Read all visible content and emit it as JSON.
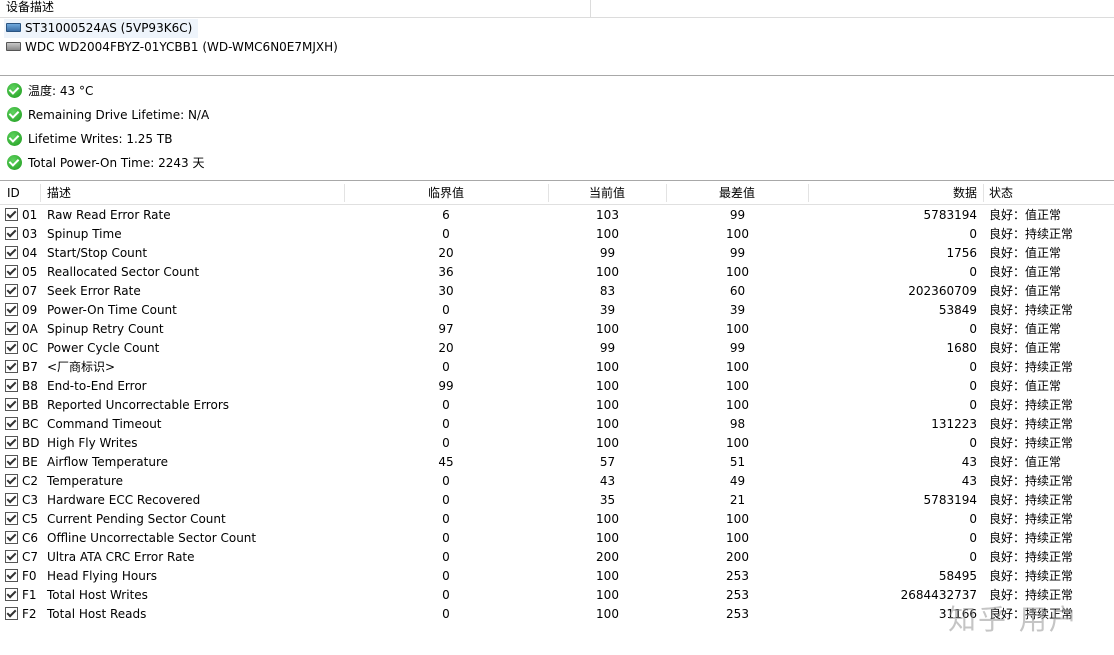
{
  "device_panel": {
    "header": "设备描述",
    "devices": [
      {
        "label": "ST31000524AS (5VP93K6C)",
        "icon": "disk-icon"
      },
      {
        "label": "WDC WD2004FBYZ-01YCBB1 (WD-WMC6N0E7MJXH)",
        "icon": "disk-icon"
      }
    ]
  },
  "status": [
    {
      "text": "温度: 43 °C",
      "icon": "ok-icon"
    },
    {
      "text": "Remaining Drive Lifetime: N/A",
      "icon": "ok-icon"
    },
    {
      "text": "Lifetime Writes: 1.25 TB",
      "icon": "ok-icon"
    },
    {
      "text": "Total Power-On Time: 2243 天",
      "icon": "ok-icon"
    }
  ],
  "table": {
    "headers": {
      "id": "ID",
      "desc": "描述",
      "threshold": "临界值",
      "current": "当前值",
      "worst": "最差值",
      "data": "数据",
      "status": "状态"
    },
    "rows": [
      {
        "id": "01",
        "desc": "Raw Read Error Rate",
        "threshold": "6",
        "current": "103",
        "worst": "99",
        "data": "5783194",
        "status": "良好：值正常"
      },
      {
        "id": "03",
        "desc": "Spinup Time",
        "threshold": "0",
        "current": "100",
        "worst": "100",
        "data": "0",
        "status": "良好：持续正常"
      },
      {
        "id": "04",
        "desc": "Start/Stop Count",
        "threshold": "20",
        "current": "99",
        "worst": "99",
        "data": "1756",
        "status": "良好：值正常"
      },
      {
        "id": "05",
        "desc": "Reallocated Sector Count",
        "threshold": "36",
        "current": "100",
        "worst": "100",
        "data": "0",
        "status": "良好：值正常"
      },
      {
        "id": "07",
        "desc": "Seek Error Rate",
        "threshold": "30",
        "current": "83",
        "worst": "60",
        "data": "202360709",
        "status": "良好：值正常"
      },
      {
        "id": "09",
        "desc": "Power-On Time Count",
        "threshold": "0",
        "current": "39",
        "worst": "39",
        "data": "53849",
        "status": "良好：持续正常"
      },
      {
        "id": "0A",
        "desc": "Spinup Retry Count",
        "threshold": "97",
        "current": "100",
        "worst": "100",
        "data": "0",
        "status": "良好：值正常"
      },
      {
        "id": "0C",
        "desc": "Power Cycle Count",
        "threshold": "20",
        "current": "99",
        "worst": "99",
        "data": "1680",
        "status": "良好：值正常"
      },
      {
        "id": "B7",
        "desc": "<厂商标识>",
        "threshold": "0",
        "current": "100",
        "worst": "100",
        "data": "0",
        "status": "良好：持续正常"
      },
      {
        "id": "B8",
        "desc": "End-to-End Error",
        "threshold": "99",
        "current": "100",
        "worst": "100",
        "data": "0",
        "status": "良好：值正常"
      },
      {
        "id": "BB",
        "desc": "Reported Uncorrectable Errors",
        "threshold": "0",
        "current": "100",
        "worst": "100",
        "data": "0",
        "status": "良好：持续正常"
      },
      {
        "id": "BC",
        "desc": "Command Timeout",
        "threshold": "0",
        "current": "100",
        "worst": "98",
        "data": "131223",
        "status": "良好：持续正常"
      },
      {
        "id": "BD",
        "desc": "High Fly Writes",
        "threshold": "0",
        "current": "100",
        "worst": "100",
        "data": "0",
        "status": "良好：持续正常"
      },
      {
        "id": "BE",
        "desc": "Airflow Temperature",
        "threshold": "45",
        "current": "57",
        "worst": "51",
        "data": "43",
        "status": "良好：值正常"
      },
      {
        "id": "C2",
        "desc": "Temperature",
        "threshold": "0",
        "current": "43",
        "worst": "49",
        "data": "43",
        "status": "良好：持续正常"
      },
      {
        "id": "C3",
        "desc": "Hardware ECC Recovered",
        "threshold": "0",
        "current": "35",
        "worst": "21",
        "data": "5783194",
        "status": "良好：持续正常"
      },
      {
        "id": "C5",
        "desc": "Current Pending Sector Count",
        "threshold": "0",
        "current": "100",
        "worst": "100",
        "data": "0",
        "status": "良好：持续正常"
      },
      {
        "id": "C6",
        "desc": "Offline Uncorrectable Sector Count",
        "threshold": "0",
        "current": "100",
        "worst": "100",
        "data": "0",
        "status": "良好：持续正常"
      },
      {
        "id": "C7",
        "desc": "Ultra ATA CRC Error Rate",
        "threshold": "0",
        "current": "200",
        "worst": "200",
        "data": "0",
        "status": "良好：持续正常"
      },
      {
        "id": "F0",
        "desc": "Head Flying Hours",
        "threshold": "0",
        "current": "100",
        "worst": "253",
        "data": "58495",
        "status": "良好：持续正常"
      },
      {
        "id": "F1",
        "desc": "Total Host Writes",
        "threshold": "0",
        "current": "100",
        "worst": "253",
        "data": "2684432737",
        "status": "良好：持续正常"
      },
      {
        "id": "F2",
        "desc": "Total Host Reads",
        "threshold": "0",
        "current": "100",
        "worst": "253",
        "data": "31166",
        "status": "良好：持续正常"
      }
    ]
  },
  "watermark": "知乎 用户"
}
